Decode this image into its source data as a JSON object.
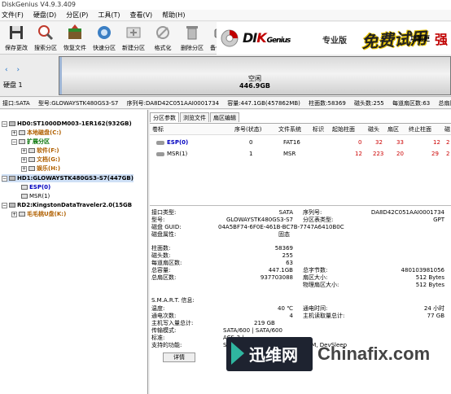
{
  "window": {
    "title": "DiskGenius V4.9.3.409"
  },
  "menu": [
    "文件(F)",
    "硬盘(D)",
    "分区(P)",
    "工具(T)",
    "查看(V)",
    "帮助(H)"
  ],
  "toolbar": {
    "items": [
      {
        "label": "保存更改",
        "icon": "save-icon"
      },
      {
        "label": "搜索分区",
        "icon": "search-partition-icon"
      },
      {
        "label": "恢复文件",
        "icon": "recover-files-icon"
      },
      {
        "label": "快速分区",
        "icon": "quick-partition-icon"
      },
      {
        "label": "新建分区",
        "icon": "new-partition-icon"
      },
      {
        "label": "格式化",
        "icon": "format-icon"
      },
      {
        "label": "删除分区",
        "icon": "delete-partition-icon"
      },
      {
        "label": "备份分区",
        "icon": "backup-partition-icon"
      }
    ]
  },
  "banner": {
    "logo_a": "DI",
    "logo_k": "K",
    "logo_b": "Genius",
    "zhuanye": "专业版",
    "promo": "免费试用",
    "features": "功能更",
    "qiang": "强"
  },
  "diskmap": {
    "nav": "‹ ›",
    "disk_label": "硬盘 1",
    "partition_name": "空闲",
    "partition_size": "446.9GB"
  },
  "infobar": [
    "接口:SATA",
    "型号:GLOWAYSTK480GS3-S7",
    "序列号:DA8D42C051AAI0001734",
    "容量:447.1GB(457862MB)",
    "柱面数:58369",
    "磁头数:255",
    "每道扇区数:63",
    "总扇区"
  ],
  "tree": {
    "hd0": "HD0:ST1000DM003-1ER162(932GB)",
    "local_c": "本地磁盘(C:)",
    "extended": "扩展分区",
    "soft_f": "软件(F:)",
    "doc_g": "文档(G:)",
    "ent_h": "娱乐(H:)",
    "hd1": "HD1:GLOWAYSTK480GS3-S7(447GB)",
    "esp": "ESP(0)",
    "msr": "MSR(1)",
    "rd2": "RD2:KingstonDataTraveler2.0(15GB",
    "usb_k": "毛毛桃U盘(K:)"
  },
  "tabs": [
    "分区参数",
    "浏览文件",
    "扇区编辑"
  ],
  "partition_table": {
    "headers": [
      "卷标",
      "序号(状态)",
      "文件系统",
      "标识",
      "起始柱面",
      "磁头",
      "扇区",
      "终止柱面",
      "磁"
    ],
    "rows": [
      {
        "label": "ESP(0)",
        "num": "0",
        "fs": "FAT16",
        "id": "",
        "start_cyl": "0",
        "head": "32",
        "sector": "33",
        "end_cyl": "12",
        "head2": "2"
      },
      {
        "label": "MSR(1)",
        "num": "1",
        "fs": "MSR",
        "id": "",
        "start_cyl": "12",
        "head": "223",
        "sector": "20",
        "end_cyl": "29",
        "head2": "2"
      }
    ]
  },
  "details": {
    "iface_label": "接口类型:",
    "iface_value": "SATA",
    "model_label": "型号:",
    "model_value": "GLOWAYSTK480GS3-S7",
    "guid_label": "磁盘 GUID:",
    "guid_value": "04A5BF74-6F0E-461B-BC7B-7747A6410B0C",
    "attr_label": "磁盘属性:",
    "attr_value": "固态",
    "serial_label": "序列号:",
    "serial_value": "DA8D42C051AAI0001734",
    "ptype_label": "分区表类型:",
    "ptype_value": "GPT",
    "cyl_label": "柱面数:",
    "cyl_value": "58369",
    "heads_label": "磁头数:",
    "heads_value": "255",
    "spt_label": "每道扇区数:",
    "spt_value": "63",
    "cap_label": "总容量:",
    "cap_value": "447.1GB",
    "bytes_label": "总字节数:",
    "bytes_value": "480103981056",
    "sectors_label": "总扇区数:",
    "sectors_value": "937703088",
    "secsize_label": "扇区大小:",
    "secsize_value": "512 Bytes",
    "physsec_label": "物理扇区大小:",
    "physsec_value": "512 Bytes",
    "smart_label": "S.M.A.R.T. 信息:",
    "temp_label": "温度:",
    "temp_value": "40 ℃",
    "poh_label": "通电时间:",
    "poh_value": "24 小时",
    "pc_label": "通电次数:",
    "pc_value": "4",
    "hr_label": "主机读取量总计:",
    "hr_value": "77 GB",
    "hw_label": "主机写入量总计:",
    "hw_value": "219 GB",
    "tm_label": "传输模式:",
    "tm_value": "SATA/600 | SATA/600",
    "std_label": "标准:",
    "std_value": "ACS-3 | ----",
    "feat_label": "支持的功能:",
    "feat_value": "S.M.A.R.T., 48bit LBA, NCQ, TRIM, DevSleep",
    "detail_button": "详情"
  },
  "watermark": {
    "brand_cn": "迅维网",
    "brand_en": "Chinafix.com"
  }
}
